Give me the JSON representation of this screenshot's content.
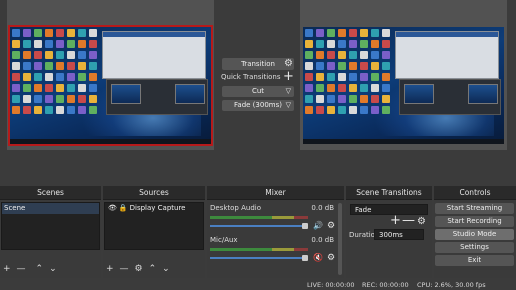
{
  "transition_panel": {
    "transition_label": "Transition",
    "quick_transitions_label": "Quick Transitions",
    "quick_items": [
      {
        "label": "Cut"
      },
      {
        "label": "Fade (300ms)"
      }
    ]
  },
  "docks": {
    "scenes": {
      "title": "Scenes",
      "items": [
        "Scene"
      ]
    },
    "sources": {
      "title": "Sources",
      "items": [
        "Display Capture"
      ]
    },
    "mixer": {
      "title": "Mixer",
      "channels": [
        {
          "name": "Desktop Audio",
          "level": "0.0 dB",
          "volume_fraction": 1.0
        },
        {
          "name": "Mic/Aux",
          "level": "0.0 dB",
          "volume_fraction": 1.0
        }
      ]
    },
    "scene_transitions": {
      "title": "Scene Transitions",
      "selected": "Fade",
      "duration_label": "Duration",
      "duration_value": "300ms"
    },
    "controls": {
      "title": "Controls",
      "buttons": [
        "Start Streaming",
        "Start Recording",
        "Studio Mode",
        "Settings",
        "Exit"
      ]
    }
  },
  "status": {
    "live": "LIVE: 00:00:00",
    "rec": "REC: 00:00:00",
    "cpu": "CPU: 2.6%, 30.00 fps"
  },
  "colors": {
    "program_border": "#b61a1a",
    "selection": "#2f3e52",
    "slider": "#4a7fc1"
  }
}
